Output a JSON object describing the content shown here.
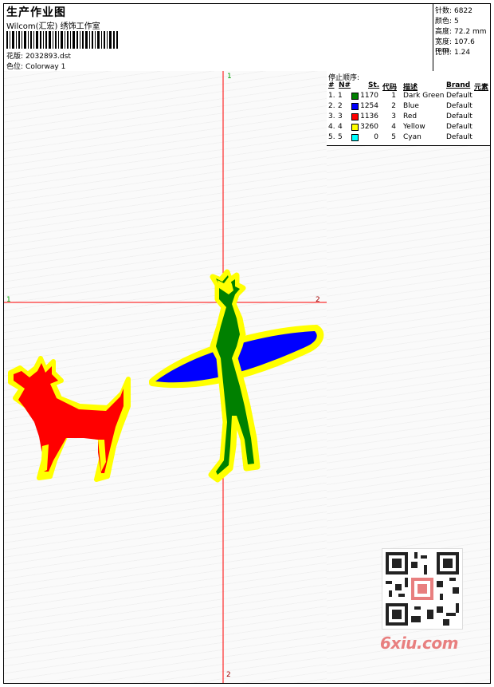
{
  "header": {
    "title": "生产作业图",
    "company": "Wilcom(汇宏) 绣饰工作室",
    "design_label": "花版:",
    "design_value": "2032893.dst",
    "colorway_label": "色位:",
    "colorway_value": "Colorway 1"
  },
  "stats": {
    "stitches_label": "针数:",
    "stitches_value": "6822",
    "colors_label": "颜色:",
    "colors_value": "5",
    "height_label": "高度:",
    "height_value": "72.2 mm",
    "width_label": "宽度:",
    "width_value": "107.6 mm",
    "ratio_label": "比例:",
    "ratio_value": "1.24"
  },
  "axes": {
    "top_label": "1",
    "left_label": "1",
    "right_label": "2",
    "bottom_label": "2"
  },
  "color_table": {
    "title": "停止顺序:",
    "headers": {
      "index": "#",
      "no": "N#",
      "stitches": "St.",
      "code": "代码",
      "description": "描述",
      "brand": "Brand",
      "element": "元素"
    },
    "rows": [
      {
        "index": "1.",
        "no": "1",
        "stitches": "1170",
        "code": "1",
        "description": "Dark Green",
        "brand": "Default",
        "color": "#008000"
      },
      {
        "index": "2.",
        "no": "2",
        "stitches": "1254",
        "code": "2",
        "description": "Blue",
        "brand": "Default",
        "color": "#0000ff"
      },
      {
        "index": "3.",
        "no": "3",
        "stitches": "1136",
        "code": "3",
        "description": "Red",
        "brand": "Default",
        "color": "#ff0000"
      },
      {
        "index": "4.",
        "no": "4",
        "stitches": "3260",
        "code": "4",
        "description": "Yellow",
        "brand": "Default",
        "color": "#ffff00"
      },
      {
        "index": "5.",
        "no": "5",
        "stitches": "0",
        "code": "5",
        "description": "Cyan",
        "brand": "Default",
        "color": "#00ffff"
      }
    ]
  },
  "watermark": {
    "text": "6xiu.com",
    "icon": "qr-code-icon"
  },
  "colors": {
    "crosshair": "#ff0000",
    "axis_label": "#00a000",
    "yellow_outline": "#ffff00",
    "watermark": "#e87f7f"
  }
}
